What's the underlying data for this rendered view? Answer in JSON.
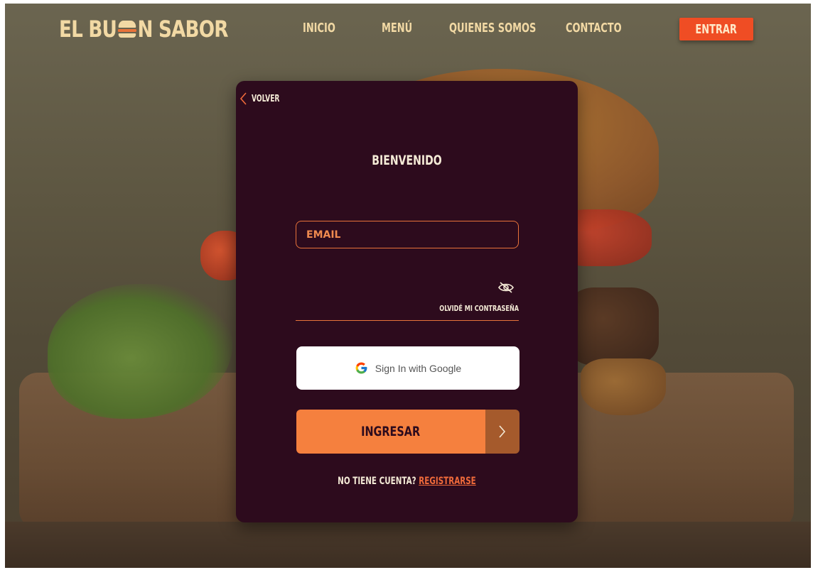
{
  "header": {
    "logo_prefix": "EL BU",
    "logo_suffix": "N SABOR",
    "nav": [
      {
        "label": "INICIO"
      },
      {
        "label": "MENÚ"
      },
      {
        "label": "QUIENES SOMOS"
      },
      {
        "label": "CONTACTO"
      }
    ],
    "login_label": "ENTRAR"
  },
  "login": {
    "back_label": "VOLVER",
    "title": "BIENVENIDO",
    "email_placeholder": "EMAIL",
    "password_value": "",
    "forgot_label": "OLVIDÉ MI CONTRASEÑA",
    "google_label": "Sign In with Google",
    "submit_label": "INGRESAR",
    "no_account_label": "NO TIENE CUENTA?",
    "register_label": "REGISTRARSE"
  },
  "icons": {
    "back": "chevron-left-icon",
    "eye": "eye-slash-icon",
    "google": "google-icon",
    "submit_arrow": "chevron-right-icon",
    "logo_burger": "burger-icon"
  },
  "colors": {
    "card_bg": "#2d0b1d",
    "accent": "#f5803e",
    "cta_red": "#ef4d24",
    "logo_cream": "#f2d9a4",
    "text_light": "#f4ead6",
    "submit_arrow_bg": "#a55a2c"
  }
}
